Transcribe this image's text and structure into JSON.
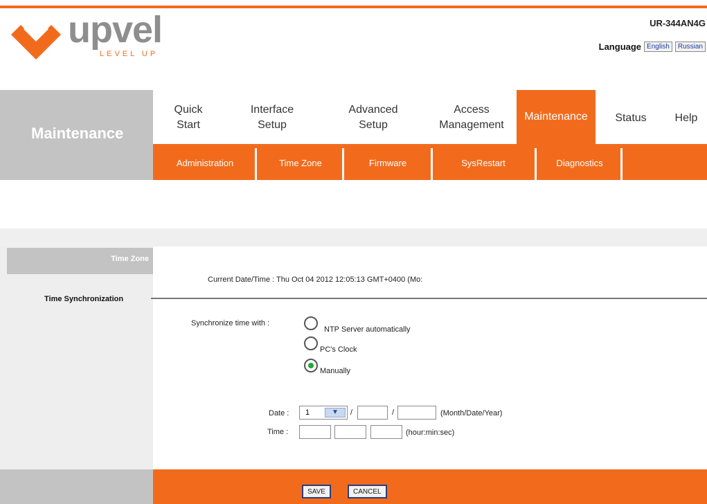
{
  "header": {
    "brand": "upvel",
    "tagline": "LEVEL UP",
    "model": "UR-344AN4G",
    "language_label": "Language",
    "languages": [
      "English",
      "Russian"
    ]
  },
  "sidebar": {
    "title": "Maintenance"
  },
  "nav": {
    "items": [
      {
        "label_line1": "Quick",
        "label_line2": "Start"
      },
      {
        "label_line1": "Interface",
        "label_line2": "Setup"
      },
      {
        "label_line1": "Advanced",
        "label_line2": "Setup"
      },
      {
        "label_line1": "Access",
        "label_line2": "Management"
      },
      {
        "label": "Maintenance"
      },
      {
        "label": "Status"
      },
      {
        "label": "Help"
      }
    ]
  },
  "subnav": [
    "Administration",
    "Time Zone",
    "Firmware",
    "SysRestart",
    "Diagnostics"
  ],
  "section": {
    "time_zone": "Time Zone",
    "time_sync": "Time Synchronization",
    "current_datetime": "Current Date/Time : Thu Oct 04 2012 12:05:13 GMT+0400 (Mo:"
  },
  "sync": {
    "label": "Synchronize time with :",
    "options": [
      "NTP Server automatically",
      "PC's Clock",
      "Manually"
    ],
    "selected": "Manually"
  },
  "date": {
    "label": "Date :",
    "month": "1",
    "day": "",
    "year": "",
    "hint": "(Month/Date/Year)"
  },
  "time": {
    "label": "Time :",
    "hour": "",
    "min": "",
    "sec": "",
    "hint": "(hour:min:sec)"
  },
  "buttons": {
    "save": "SAVE",
    "cancel": "CANCEL"
  },
  "colors": {
    "accent": "#f26b1d",
    "gray": "#c3c3c3"
  }
}
